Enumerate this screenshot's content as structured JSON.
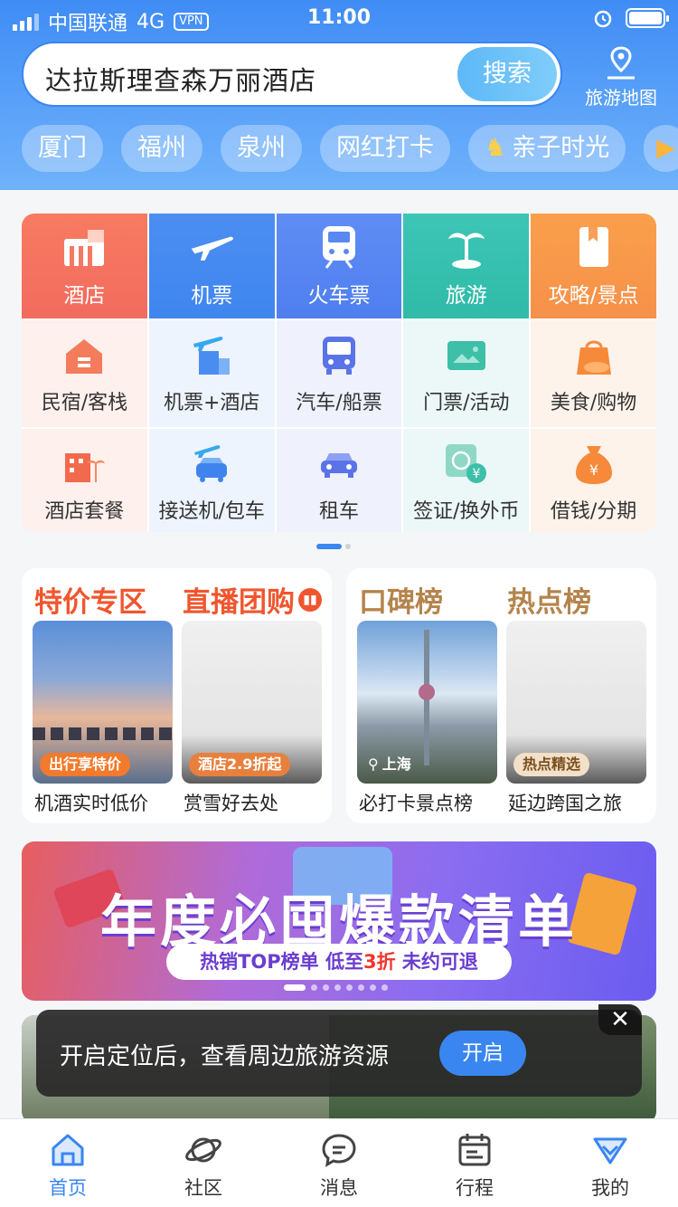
{
  "status": {
    "carrier": "中国联通",
    "network": "4G",
    "vpn": "VPN",
    "time": "11:00"
  },
  "search": {
    "value": "达拉斯理查森万丽酒店",
    "button": "搜索",
    "map_label": "旅游地图"
  },
  "chips": [
    "厦门",
    "福州",
    "泉州",
    "网红打卡",
    "亲子时光"
  ],
  "grid": [
    {
      "label": "酒店",
      "icon": "hotel-icon"
    },
    {
      "label": "机票",
      "icon": "plane-icon"
    },
    {
      "label": "火车票",
      "icon": "train-icon"
    },
    {
      "label": "旅游",
      "icon": "palm-icon"
    },
    {
      "label": "攻略/景点",
      "icon": "guide-icon"
    },
    {
      "label": "民宿/客栈",
      "icon": "house-icon"
    },
    {
      "label": "机票+酒店",
      "icon": "plane-hotel-icon"
    },
    {
      "label": "汽车/船票",
      "icon": "bus-icon"
    },
    {
      "label": "门票/活动",
      "icon": "ticket-icon"
    },
    {
      "label": "美食/购物",
      "icon": "shopping-icon"
    },
    {
      "label": "酒店套餐",
      "icon": "hotel-package-icon"
    },
    {
      "label": "接送机/包车",
      "icon": "transfer-icon"
    },
    {
      "label": "租车",
      "icon": "car-icon"
    },
    {
      "label": "签证/换外币",
      "icon": "visa-icon"
    },
    {
      "label": "借钱/分期",
      "icon": "money-bag-icon"
    }
  ],
  "cards": {
    "left": {
      "title1": "特价专区",
      "title2": "直播团购",
      "tile1_tag": "出行享特价",
      "tile1_caption": "机酒实时低价",
      "tile2_tag": "酒店2.9折起",
      "tile2_caption": "赏雪好去处"
    },
    "right": {
      "title1": "口碑榜",
      "title2": "热点榜",
      "tile1_tag": "上海",
      "tile1_caption": "必打卡景点榜",
      "tile2_tag": "热点精选",
      "tile2_caption": "延边跨国之旅"
    }
  },
  "banner": {
    "title": "年度必囤爆款清单",
    "sub_pre": "热销TOP榜单 低至",
    "sub_hl": "3折",
    "sub_post": " 未约可退"
  },
  "toast": {
    "message": "开启定位后，查看周边旅游资源",
    "button": "开启",
    "close": "✕"
  },
  "tabs": [
    {
      "label": "首页",
      "icon": "home-icon"
    },
    {
      "label": "社区",
      "icon": "planet-icon"
    },
    {
      "label": "消息",
      "icon": "message-icon"
    },
    {
      "label": "行程",
      "icon": "calendar-icon"
    },
    {
      "label": "我的",
      "icon": "profile-icon"
    }
  ]
}
